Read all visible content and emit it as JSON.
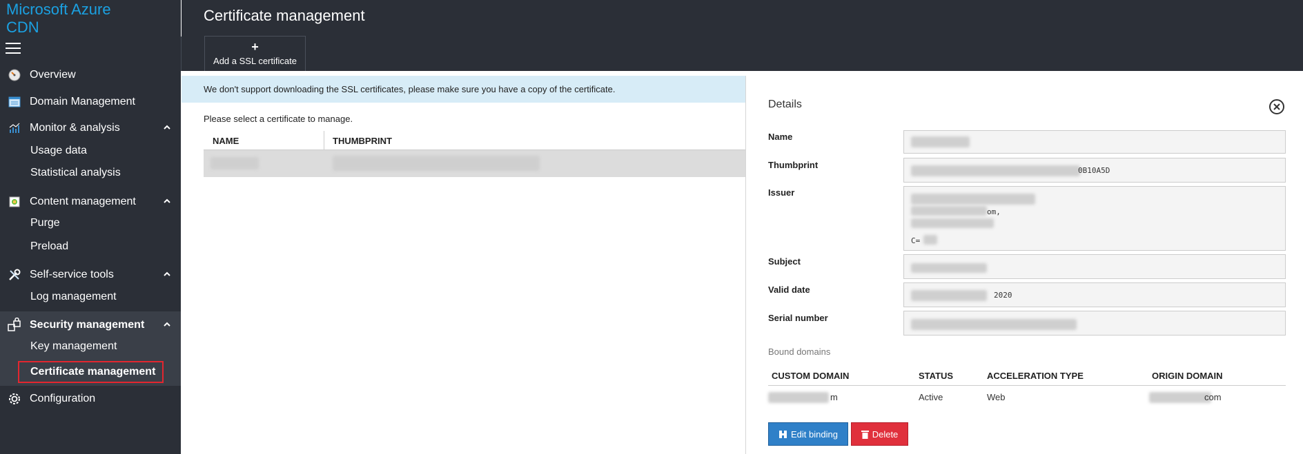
{
  "brand": {
    "line1": "Microsoft Azure",
    "line2": "CDN"
  },
  "header": {
    "title": "Certificate management",
    "add_button": "Add a SSL certificate"
  },
  "sidebar": {
    "items": [
      {
        "label": "Overview",
        "icon": "gauge-icon"
      },
      {
        "label": "Domain Management",
        "icon": "domain-list-icon"
      },
      {
        "label": "Monitor & analysis",
        "icon": "chart-icon",
        "children": [
          "Usage data",
          "Statistical analysis"
        ]
      },
      {
        "label": "Content management",
        "icon": "content-icon",
        "children": [
          "Purge",
          "Preload"
        ]
      },
      {
        "label": "Self-service tools",
        "icon": "tools-icon",
        "children": [
          "Log management"
        ]
      },
      {
        "label": "Security management",
        "icon": "security-icon",
        "children": [
          "Key management",
          "Certificate management"
        ]
      },
      {
        "label": "Configuration",
        "icon": "gear-icon"
      }
    ]
  },
  "main": {
    "notice": "We don't support downloading the SSL certificates, please make sure you have a copy of the certificate.",
    "select_hint": "Please select a certificate to manage.",
    "columns": [
      "NAME",
      "THUMBPRINT"
    ]
  },
  "details": {
    "title": "Details",
    "fields": {
      "name_label": "Name",
      "thumbprint_label": "Thumbprint",
      "thumbprint_value": "0B10A5D",
      "issuer_label": "Issuer",
      "issuer_line2": "om,",
      "issuer_line4": "C=",
      "subject_label": "Subject",
      "valid_date_label": "Valid date",
      "valid_date_value": "2020",
      "serial_label": "Serial number"
    },
    "bound_label": "Bound domains",
    "domain_columns": [
      "CUSTOM DOMAIN",
      "STATUS",
      "ACCELERATION TYPE",
      "ORIGIN DOMAIN"
    ],
    "domain_row": {
      "custom": "m",
      "status": "Active",
      "type": "Web",
      "origin": "com"
    },
    "edit_button": "Edit binding",
    "delete_button": "Delete"
  },
  "colors": {
    "sidebar": "#2b2f37",
    "brand": "#1ba1e2",
    "notice": "#d7ecf7",
    "edit": "#2f80c8",
    "delete": "#e0303c",
    "highlight": "#e3262f"
  }
}
